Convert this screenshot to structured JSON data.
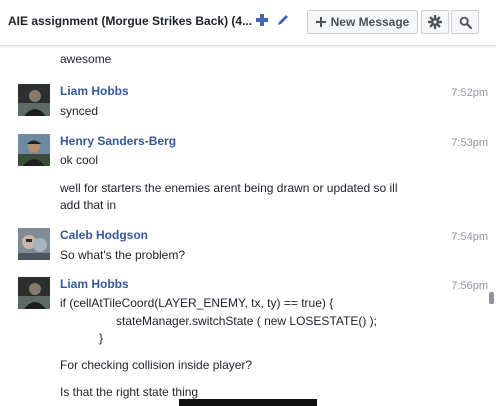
{
  "header": {
    "title": "AIE assignment (Morgue Strikes Back)  (4...",
    "new_message_label": "New Message",
    "icons": [
      "plus-icon",
      "pencil-icon",
      "gear-icon",
      "search-icon"
    ]
  },
  "messages": [
    {
      "text": "awesome"
    },
    {
      "sender": "Liam Hobbs",
      "time": "7:52pm",
      "lines": [
        "synced"
      ]
    },
    {
      "sender": "Henry Sanders-Berg",
      "time": "7:53pm",
      "lines": [
        "ok cool",
        "well for starters the enemies arent being drawn or updated so ill",
        "add that in"
      ]
    },
    {
      "sender": "Caleb Hodgson",
      "time": "7:54pm",
      "lines": [
        "So what's the problem?"
      ]
    },
    {
      "sender": "Liam Hobbs",
      "time": "7:56pm",
      "lines": [
        "if (cellAtTileCoord(LAYER_ENEMY, tx, ty) == true) {",
        "stateManager.switchState ( new LOSESTATE() );",
        "}",
        "For checking collision inside player?",
        "Is that the right state thing"
      ]
    }
  ],
  "colors": {
    "accent": "#4267b2",
    "sender": "#365899",
    "time": "#90949c",
    "text": "#1d2129"
  }
}
